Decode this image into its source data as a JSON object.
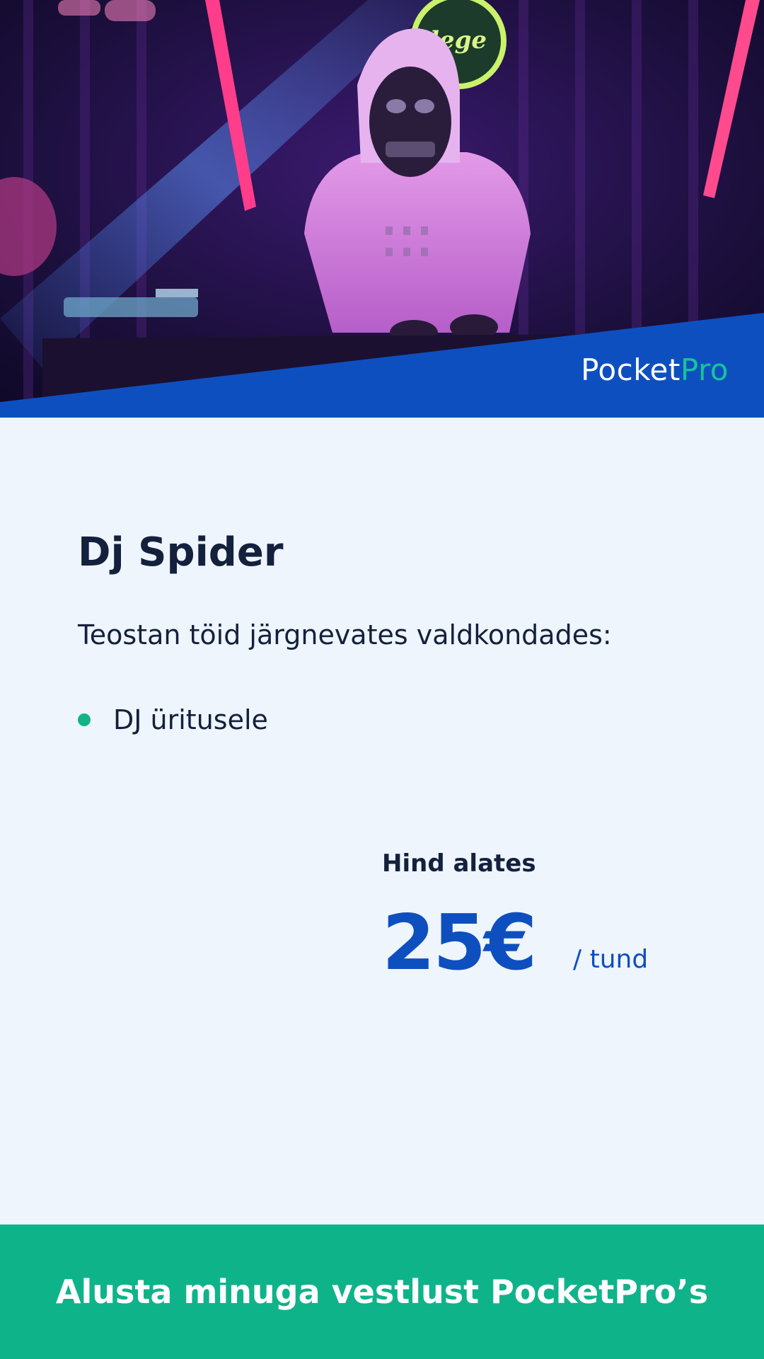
{
  "profile": {
    "name": "Dj Spider",
    "intro": "Teostan töid järgnevates valdkondades:",
    "services": [
      "DJ üritusele"
    ]
  },
  "brand": {
    "logo_main": "Pocket",
    "logo_accent": "Pro",
    "primary_color": "#0e4fc0",
    "accent_color": "#19c39a"
  },
  "pricing": {
    "label": "Hind alates",
    "amount": "25€",
    "unit": "/ tund"
  },
  "cta": {
    "label": "Alusta minuga vestlust PocketPro’s"
  }
}
